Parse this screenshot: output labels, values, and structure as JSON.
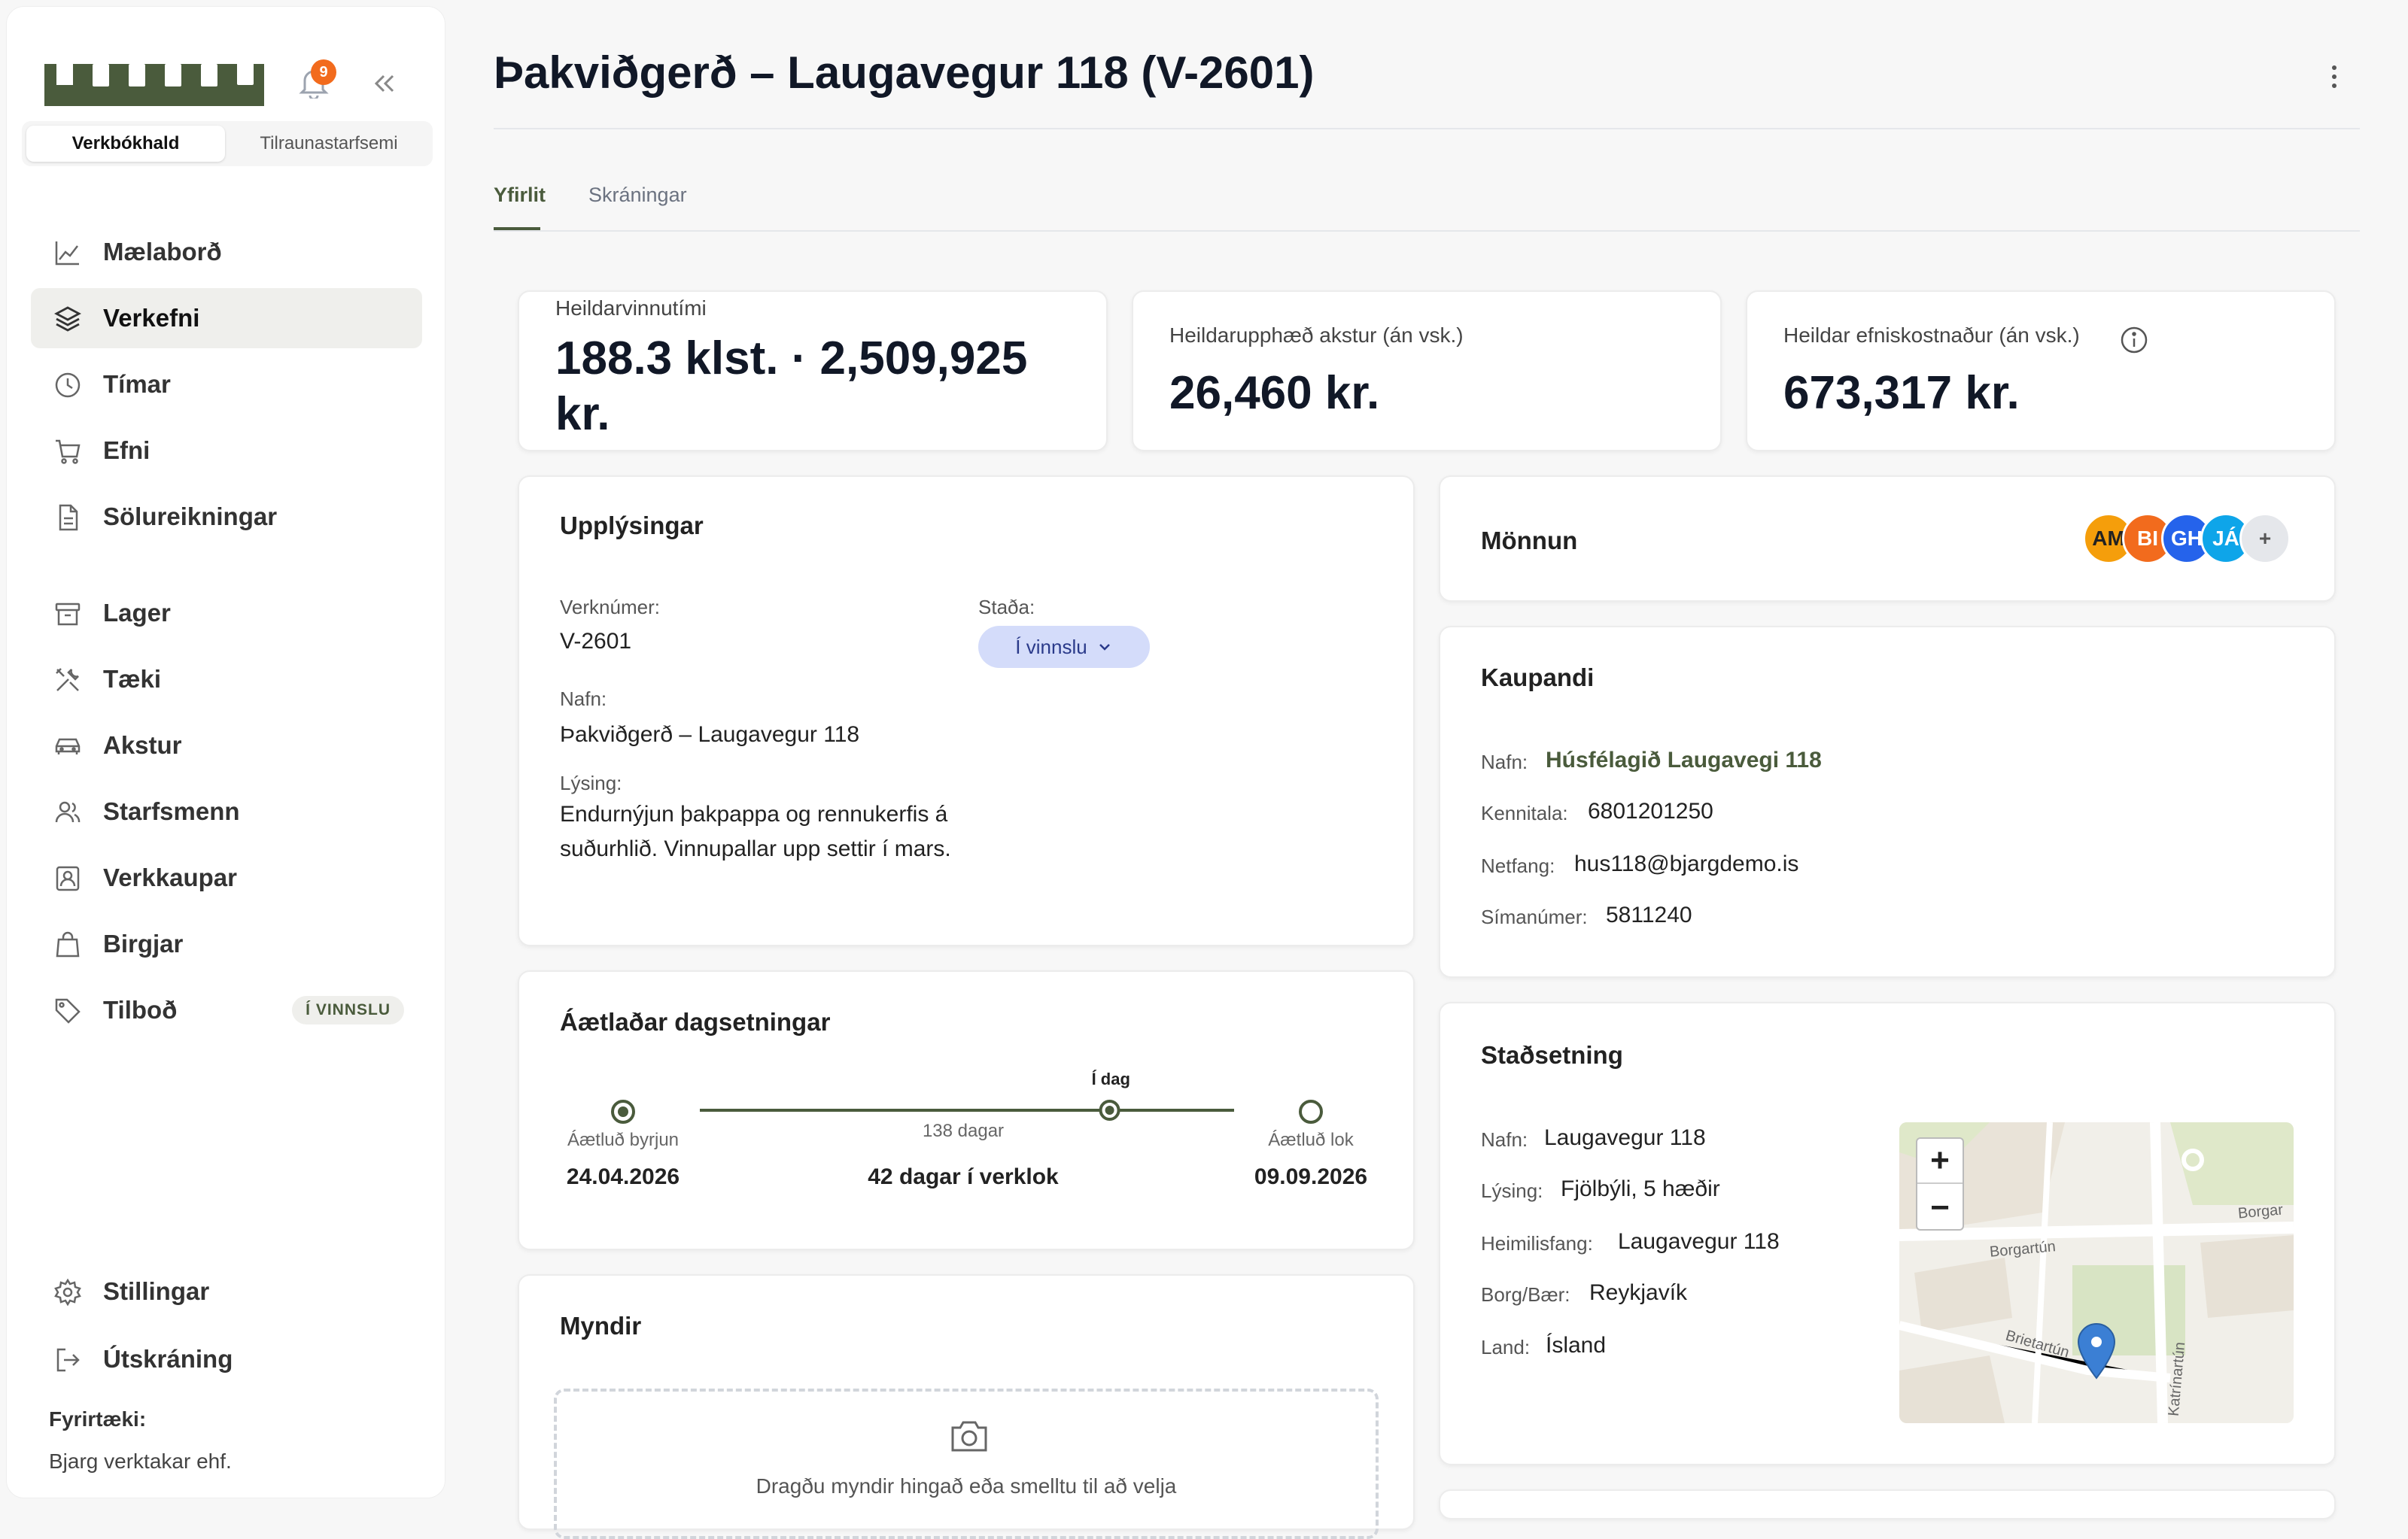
{
  "sidebar": {
    "notifications_count": "9",
    "segments": [
      "Verkbókhald",
      "Tilraunastarfsemi"
    ],
    "nav_primary": [
      {
        "label": "Mælaborð",
        "icon": "chart-line-icon"
      },
      {
        "label": "Verkefni",
        "icon": "layers-icon"
      },
      {
        "label": "Tímar",
        "icon": "clock-icon"
      },
      {
        "label": "Efni",
        "icon": "cart-icon"
      },
      {
        "label": "Sölureikningar",
        "icon": "document-icon"
      }
    ],
    "nav_secondary": [
      {
        "label": "Lager",
        "icon": "archive-icon"
      },
      {
        "label": "Tæki",
        "icon": "tools-icon"
      },
      {
        "label": "Akstur",
        "icon": "car-icon"
      },
      {
        "label": "Starfsmenn",
        "icon": "users-icon"
      },
      {
        "label": "Verkkaupar",
        "icon": "contact-icon"
      },
      {
        "label": "Birgjar",
        "icon": "bag-icon"
      },
      {
        "label": "Tilboð",
        "icon": "tag-icon",
        "badge": "Í VINNSLU"
      }
    ],
    "nav_bottom": [
      {
        "label": "Stillingar",
        "icon": "gear-icon"
      },
      {
        "label": "Útskráning",
        "icon": "logout-icon"
      }
    ],
    "company_label": "Fyrirtæki:",
    "company_name": "Bjarg verktakar ehf."
  },
  "header": {
    "title": "Þakviðgerð – Laugavegur 118 (V-2601)",
    "tabs": [
      "Yfirlit",
      "Skráningar"
    ]
  },
  "stats": [
    {
      "label": "Heildarvinnutími",
      "value": "188.3 klst. · 2,509,925 kr."
    },
    {
      "label": "Heildarupphæð akstur (án vsk.)",
      "value": "26,460 kr."
    },
    {
      "label": "Heildar efniskostnaður (án vsk.)",
      "value": "673,317 kr."
    }
  ],
  "info": {
    "title": "Upplýsingar",
    "number_label": "Verknúmer:",
    "number": "V-2601",
    "status_label": "Staða:",
    "status": "Í vinnslu",
    "name_label": "Nafn:",
    "name": "Þakviðgerð – Laugavegur 118",
    "description_label": "Lýsing:",
    "description": "Endurnýjun þakpappa og rennukerfis á suðurhlið. Vinnupallar upp settir í mars."
  },
  "dates": {
    "title": "Áætlaðar dagsetningar",
    "today_label": "Í dag",
    "start_label": "Áætluð byrjun",
    "start_date": "24.04.2026",
    "elapsed": "138 dagar",
    "remaining": "42 dagar í verklok",
    "end_label": "Áætluð lok",
    "end_date": "09.09.2026",
    "progress_fraction": 0.767
  },
  "photos": {
    "title": "Myndir",
    "upload_hint": "Dragðu myndir hingað eða smelltu til að velja"
  },
  "staffing": {
    "title": "Mönnun",
    "avatars": [
      {
        "initials": "AM",
        "color": "#f59e0b"
      },
      {
        "initials": "BI",
        "color": "#f26b1d"
      },
      {
        "initials": "GH",
        "color": "#2563eb"
      },
      {
        "initials": "JÁ",
        "color": "#0ea5e9"
      }
    ],
    "add_label": "+"
  },
  "buyer": {
    "title": "Kaupandi",
    "name_label": "Nafn:",
    "name": "Húsfélagið Laugavegi 118",
    "ssn_label": "Kennitala:",
    "ssn": "6801201250",
    "email_label": "Netfang:",
    "email": "hus118@bjargdemo.is",
    "phone_label": "Símanúmer:",
    "phone": "5811240"
  },
  "location": {
    "title": "Staðsetning",
    "name_label": "Nafn:",
    "name": "Laugavegur 118",
    "description_label": "Lýsing:",
    "description": "Fjölbýli, 5 hæðir",
    "address_label": "Heimilisfang:",
    "address": "Laugavegur 118",
    "city_label": "Borg/Bær:",
    "city": "Reykjavík",
    "country_label": "Land:",
    "country": "Ísland",
    "map_streets": [
      "Borgartún",
      "Borgar",
      "Brietartún",
      "Katrínartún"
    ],
    "zoom_in": "+",
    "zoom_out": "−"
  },
  "colors": {
    "accent": "#4a5b3c",
    "status_bg": "#d4dcfa",
    "badge": "#f26b1d"
  }
}
